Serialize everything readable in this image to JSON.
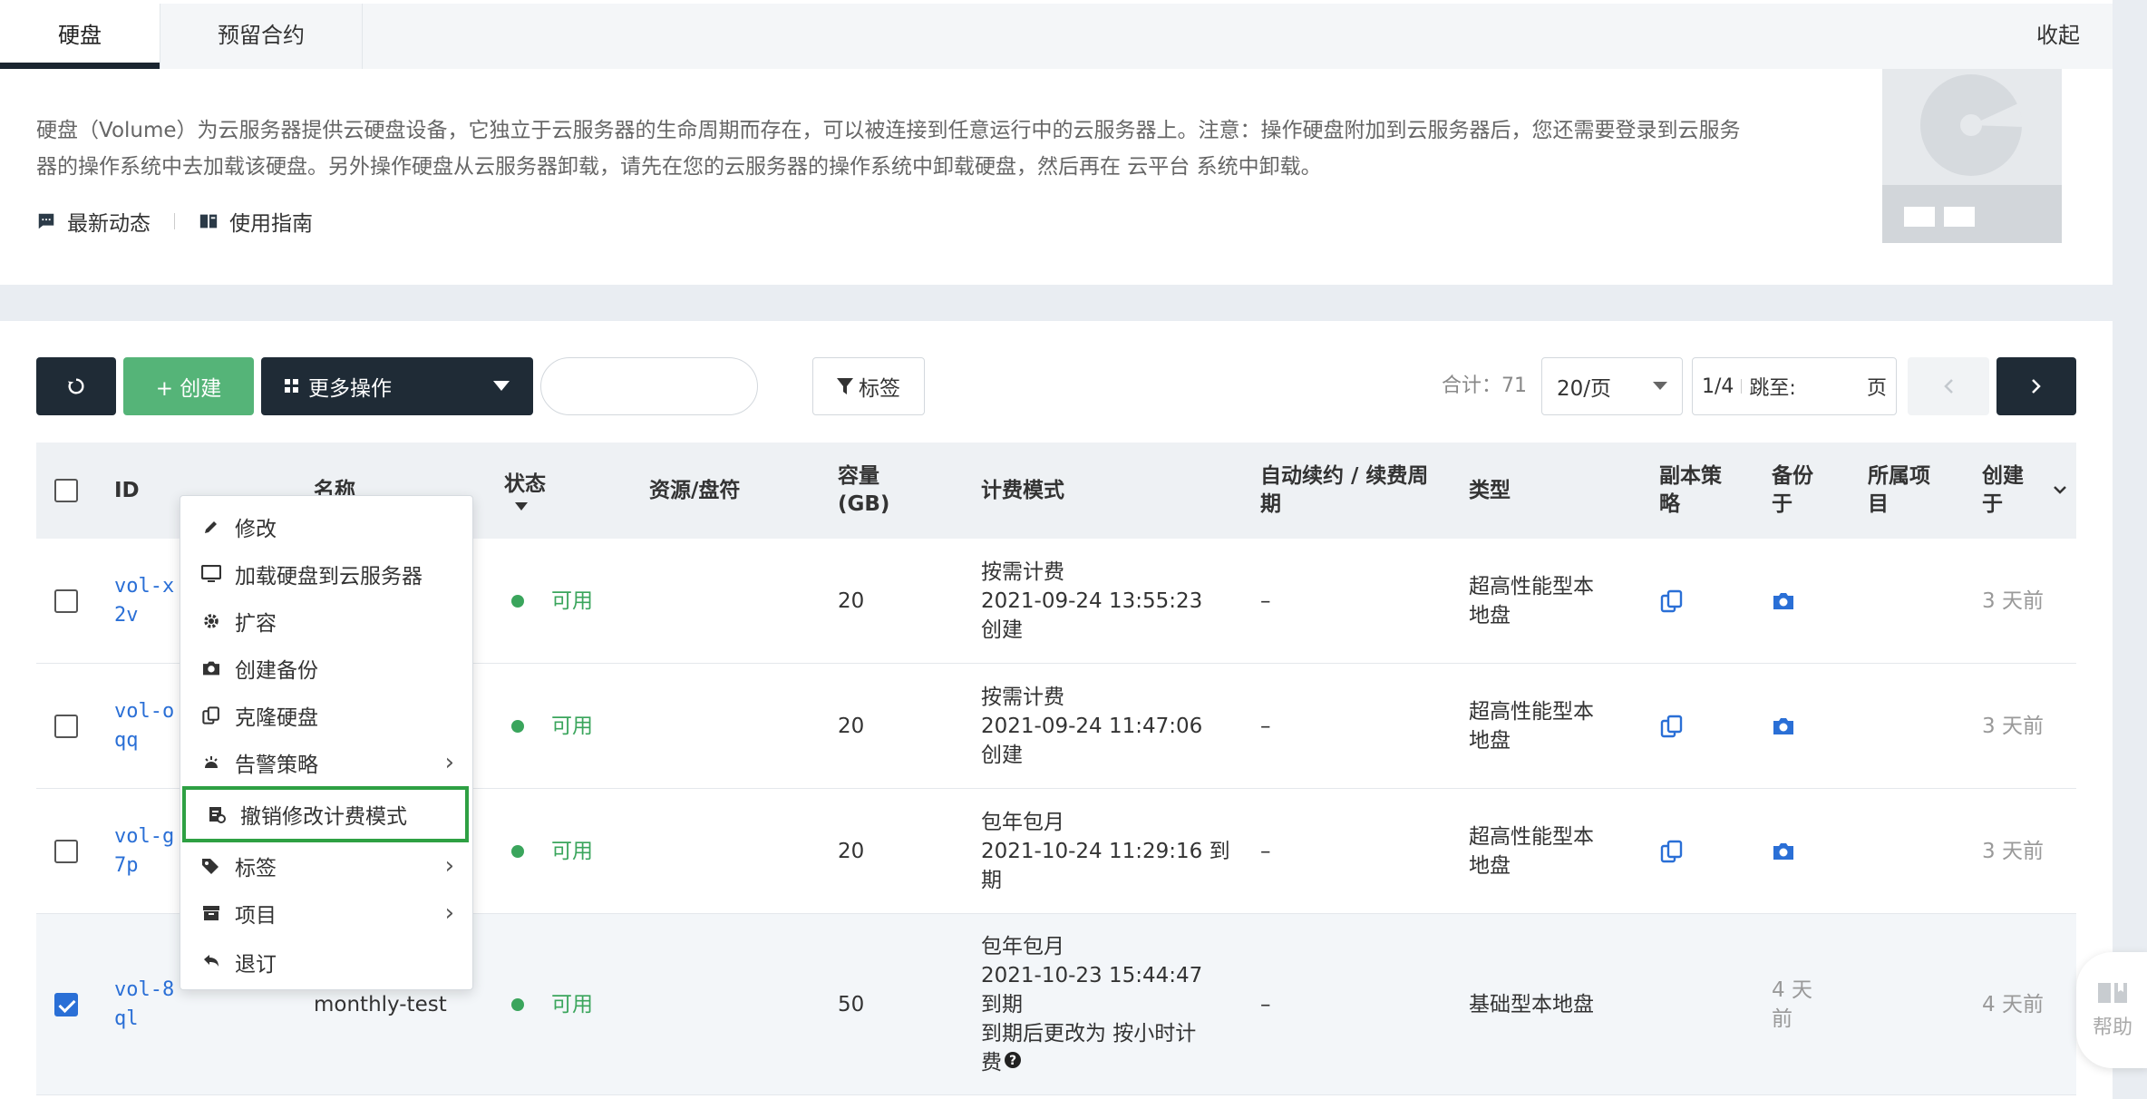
{
  "tabs": [
    {
      "label": "硬盘",
      "active": true
    },
    {
      "label": "预留合约",
      "active": false
    }
  ],
  "collapse_label": "收起",
  "description": "硬盘（Volume）为云服务器提供云硬盘设备，它独立于云服务器的生命周期而存在，可以被连接到任意运行中的云服务器上。注意：操作硬盘附加到云服务器后，您还需要登录到云服务器的操作系统中去加载该硬盘。另外操作硬盘从云服务器卸载，请先在您的云服务器的操作系统中卸载硬盘，然后再在 云平台 系统中卸载。",
  "links": {
    "news": "最新动态",
    "guide": "使用指南"
  },
  "toolbar": {
    "create_label": "+ 创建",
    "more_label": "更多操作",
    "search_placeholder": "",
    "tag_label": "标签",
    "total": "合计：71",
    "page_size": "20/页",
    "page": "1/4",
    "jump_label": "跳至:",
    "page_unit": "页"
  },
  "columns": {
    "id": "ID",
    "name": "名称",
    "status": "状态",
    "resource": "资源/盘符",
    "capacity": "容量 (GB)",
    "billing": "计费模式",
    "renew": "自动续约 / 续费周期",
    "type": "类型",
    "replica": "副本策略",
    "backup": "备份于",
    "project": "所属项目",
    "created": "创建于"
  },
  "rows": [
    {
      "id": "vol-x",
      "id2": "2v",
      "status": "可用",
      "capacity": "20",
      "billing": [
        "按需计费",
        "2021-09-24 13:55:23",
        "创建"
      ],
      "renew": "–",
      "type": "超高性能型本地盘",
      "created": "3 天前",
      "checked": false
    },
    {
      "id": "vol-o",
      "id2": "qq",
      "status": "可用",
      "capacity": "20",
      "billing": [
        "按需计费",
        "2021-09-24 11:47:06",
        "创建"
      ],
      "renew": "–",
      "type": "超高性能型本地盘",
      "created": "3 天前",
      "checked": false
    },
    {
      "id": "vol-g",
      "id2": "7p",
      "status": "可用",
      "capacity": "20",
      "billing": [
        "包年包月",
        "2021-10-24 11:29:16 到",
        "期"
      ],
      "renew": "–",
      "type": "超高性能型本地盘",
      "created": "3 天前",
      "checked": false
    },
    {
      "id": "vol-8",
      "id2": "ql",
      "name": "monthly-test",
      "status": "可用",
      "capacity": "50",
      "billing": [
        "包年包月",
        "2021-10-23 15:44:47",
        "到期",
        "到期后更改为 按小时计",
        "费"
      ],
      "renew": "–",
      "type": "基础型本地盘",
      "backup": "4 天前",
      "created": "4 天前",
      "checked": true
    }
  ],
  "context_menu": [
    {
      "label": "修改",
      "icon": "pencil-icon"
    },
    {
      "label": "加载硬盘到云服务器",
      "icon": "monitor-icon"
    },
    {
      "label": "扩容",
      "icon": "gear-icon"
    },
    {
      "label": "创建备份",
      "icon": "camera-icon"
    },
    {
      "label": "克隆硬盘",
      "icon": "clone-icon"
    },
    {
      "label": "告警策略",
      "icon": "alarm-icon",
      "submenu": true
    },
    {
      "label": "撤销修改计费模式",
      "icon": "billing-icon",
      "highlighted": true
    },
    {
      "label": "标签",
      "icon": "tag-icon",
      "submenu": true
    },
    {
      "label": "项目",
      "icon": "archive-icon",
      "submenu": true
    },
    {
      "label": "退订",
      "icon": "undo-icon"
    }
  ],
  "help_label": "帮助",
  "colors": {
    "primary_dark": "#1f2b36",
    "green": "#55b478",
    "status_green": "#3aa55c",
    "link_blue": "#2a6fd6",
    "highlight": "#2ea043"
  }
}
